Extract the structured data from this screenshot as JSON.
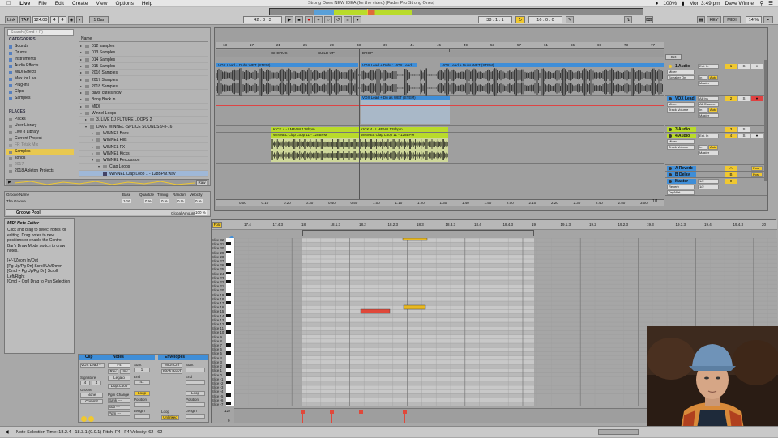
{
  "menubar": {
    "app": "Live",
    "items": [
      "File",
      "Edit",
      "Create",
      "View",
      "Options",
      "Help"
    ],
    "title": "Strong Ones NEW IDEA (for the video)  [Fader Pro Strong Ones]",
    "battery": "100%",
    "clock": "Mon 3:49 pm",
    "user": "Dave Winnel"
  },
  "transport": {
    "link": "Link",
    "tap": "TAP",
    "tempo": "124.00",
    "meter_num": "4",
    "meter_den": "4",
    "quant": "1 Bar",
    "position": "42 . 3 . 3",
    "loop_start": "38 . 1 . 1",
    "loop_length": "16 . 0 . 0",
    "key": "KEY",
    "midi": "MIDI",
    "cpu": "14 %",
    "user": "Dave Winnel"
  },
  "browser": {
    "search_placeholder": "Search (Cmd + F)",
    "categories_header": "CATEGORIES",
    "categories": [
      "Sounds",
      "Drums",
      "Instruments",
      "Audio Effects",
      "MIDI Effects",
      "Max for Live",
      "Plug-ins",
      "Clips",
      "Samples"
    ],
    "places_header": "PLACES",
    "places": [
      "Packs",
      "User Library",
      "Live 8 Library",
      "Current Project",
      "FR Tetak Mix",
      "Samples",
      "songs",
      "2017",
      "2018 Ableton Projects"
    ],
    "name_header": "Name",
    "files": [
      "012 samples",
      "013 Samples",
      "014 Samples",
      "015 Samples",
      "2016 Samples",
      "2017 Samples",
      "2018 Samples",
      "davs' cutels now",
      "Bring Back in",
      "MIDI",
      "Winnel Loops",
      "3. LIVE DJ FUTURE LOOPS 2",
      "DAVE WINNEL -SPLICE SOUNDS 9-8-16",
      "WINNEL Bass",
      "WINNEL Fills",
      "WINNEL FX",
      "WINNEL Kicks",
      "WINNEL Percussion",
      "Clap Loops",
      "WINNEL Clap Loop 1 - 128BPM.wav"
    ],
    "raw_button": "Raw"
  },
  "groove": {
    "headers": [
      "Groove Name",
      "Base",
      "Quantize",
      "Timing",
      "Random",
      "Velocity"
    ],
    "name": "The Groove",
    "base": "1/16",
    "quantize": "0 %",
    "timing": "0 %",
    "random": "0 %",
    "velocity": "0 %",
    "pool_label": "Groove Pool",
    "global_amount_label": "Global Amount",
    "global_amount": "100 %"
  },
  "info": {
    "title": "MIDI Note Editor",
    "body": "Click and drag to select notes for editing. Drag notes to new positions or enable the Control Bar's Draw Mode switch to draw notes.",
    "shortcuts": [
      "[+/-] Zoom In/Out",
      "[Pg Up/Pg Dn] Scroll Up/Down",
      "[Cmd + Pg Up/Pg Dn] Scroll Left/Right",
      "[Cmd + Opt] Drag to Pan Selection"
    ]
  },
  "arrangement": {
    "bar_numbers": [
      "13",
      "17",
      "21",
      "25",
      "29",
      "33",
      "37",
      "41",
      "45",
      "49",
      "53",
      "57",
      "61",
      "65",
      "69",
      "73",
      "77"
    ],
    "locators": [
      "CHORUS",
      "BUILD UP",
      "DROP"
    ],
    "time_labels": [
      "0:00",
      "0:10",
      "0:20",
      "0:30",
      "0:40",
      "0:50",
      "1:00",
      "1:10",
      "1:20",
      "1:30",
      "1:40",
      "1:50",
      "2:00",
      "2:10",
      "2:20",
      "2:30",
      "2:40",
      "2:50",
      "3:00"
    ],
    "page": "1/1",
    "clips": {
      "vox_a": "VOX Lead + Dubs WET (STEM)",
      "vox_b": "VOX Lead + Dubs WET (STEM)",
      "vox_c": "VOX Lead",
      "vox_d": "VOX Lead + Dubs WET (STEM)",
      "vox_e": "VOX Lead + Du as WET (STEM)",
      "kick_a": "KICK 4 - LMFAW 128bpm",
      "kick_b": "KICK 4 - LMFAW 128bpm",
      "clap_a": "WINNEL Clap Loop 11 - 128BPM",
      "clap_b": "WINNEL Clap Loop 11 - 128BPM"
    },
    "tracks": [
      {
        "name": "1 Audio",
        "input": "Ext. In",
        "route": "Master",
        "num": "1",
        "color": "#f0c830"
      },
      {
        "name": "VOX Lead",
        "input": "All Ins",
        "route": "Master",
        "num": "2",
        "color": "#3f8ed8"
      },
      {
        "name": "3 Audio",
        "input": "Ext. In",
        "route": "Master",
        "num": "3",
        "color": "#b9db2a"
      },
      {
        "name": "4 Audio",
        "input": "Ext. In",
        "route": "Master",
        "num": "4",
        "color": "#b9db2a"
      },
      {
        "name": "A Reverb",
        "input": "",
        "route": "Master",
        "num": "A",
        "color": "#3f8ed8"
      },
      {
        "name": "B Delay",
        "input": "",
        "route": "Master",
        "num": "B",
        "color": "#3f8ed8"
      },
      {
        "name": "Master",
        "input": "1/2",
        "route": "1/2",
        "num": "0",
        "color": "#3f8ed8"
      }
    ],
    "set_button": "Set",
    "mixer_labels": {
      "in": "In",
      "auto": "Auto",
      "off": "Off",
      "track_volume": "Track Volume",
      "speaker_on": "Speaker On",
      "mixer": "Mixer",
      "all_channels": "All Channe",
      "reverb_gain": "Reverb",
      "dry_wet": "Dry/Wet"
    }
  },
  "clipview": {
    "clip_header": "Clip",
    "notes_header": "Notes",
    "envelopes_header": "Envelopes",
    "clip_name": "VOX Lead +",
    "signature_label": "Signature",
    "sig_num": "4",
    "sig_den": "4",
    "groove_label": "Groove",
    "groove_value": "None",
    "commit": "Commit",
    "notes_key": "F4",
    "rev": "Rev",
    "inv": "Inv",
    "legato": "Legato",
    "dupl_loop": "Dupl.Loop",
    "pgm_change": "Pgm Change",
    "bank": "Bank ---",
    "sub": "Sub ---",
    "pgm": "Pgm ---",
    "start_label": "Start",
    "end_label": "End",
    "loop_button": "Loop",
    "position_label": "Position",
    "length_label": "Length",
    "start_val": "1",
    "end_val": "41",
    "env_device": "MIDI Ctrl",
    "env_param": "Pitch Bend",
    "env_start": "Start",
    "env_end": "End",
    "env_loop": "Loop",
    "env_unlinked": "Unlinked",
    "env_position": "Position",
    "env_length": "Length"
  },
  "pianoroll": {
    "fold_button": "Fold",
    "ruler": [
      "17.4",
      "17.4.3",
      "18",
      "18.1.3",
      "18.2",
      "18.2.3",
      "18.3",
      "18.3.3",
      "18.4",
      "18.4.3",
      "19",
      "19.1.3",
      "19.2",
      "19.2.3",
      "19.3",
      "19.3.3",
      "19.4",
      "19.4.3",
      "20"
    ],
    "key_labels": [
      "Slice 32",
      "Slice 31",
      "Slice 30",
      "Slice 29",
      "Slice 28",
      "Slice 27",
      "Slice 26",
      "Slice 25",
      "Slice 24",
      "Slice 23",
      "Slice 22",
      "Slice 21",
      "Slice 20",
      "Slice 19",
      "Slice 18",
      "Slice 17",
      "Slice 16",
      "Slice 15",
      "Slice 14",
      "Slice 13",
      "Slice 12",
      "Slice 11",
      "Slice 10",
      "Slice 9",
      "Slice 8",
      "Slice 7",
      "Slice 6",
      "Slice 5",
      "Slice 4",
      "Slice 3",
      "Slice 2",
      "Slice 1",
      "Slice 0",
      "Slice -1",
      "Slice -2",
      "Slice -3",
      "Slice -4",
      "Slice -5",
      "Slice -6",
      "Slice -7"
    ],
    "velocity_max": "127",
    "velocity_min": "0"
  },
  "status": {
    "text": "Note Selection    Time: 18.2.4 - 18.3.1 (0.0.1)    Pitch: F4 - F4    Velocity: 62 - 62"
  },
  "colors": {
    "clip_blue": "#3f8ed8",
    "clip_green": "#b9db2a",
    "accent_yellow": "#f0c830",
    "note_red": "#e0483a",
    "note_yellow": "#e8b820"
  }
}
